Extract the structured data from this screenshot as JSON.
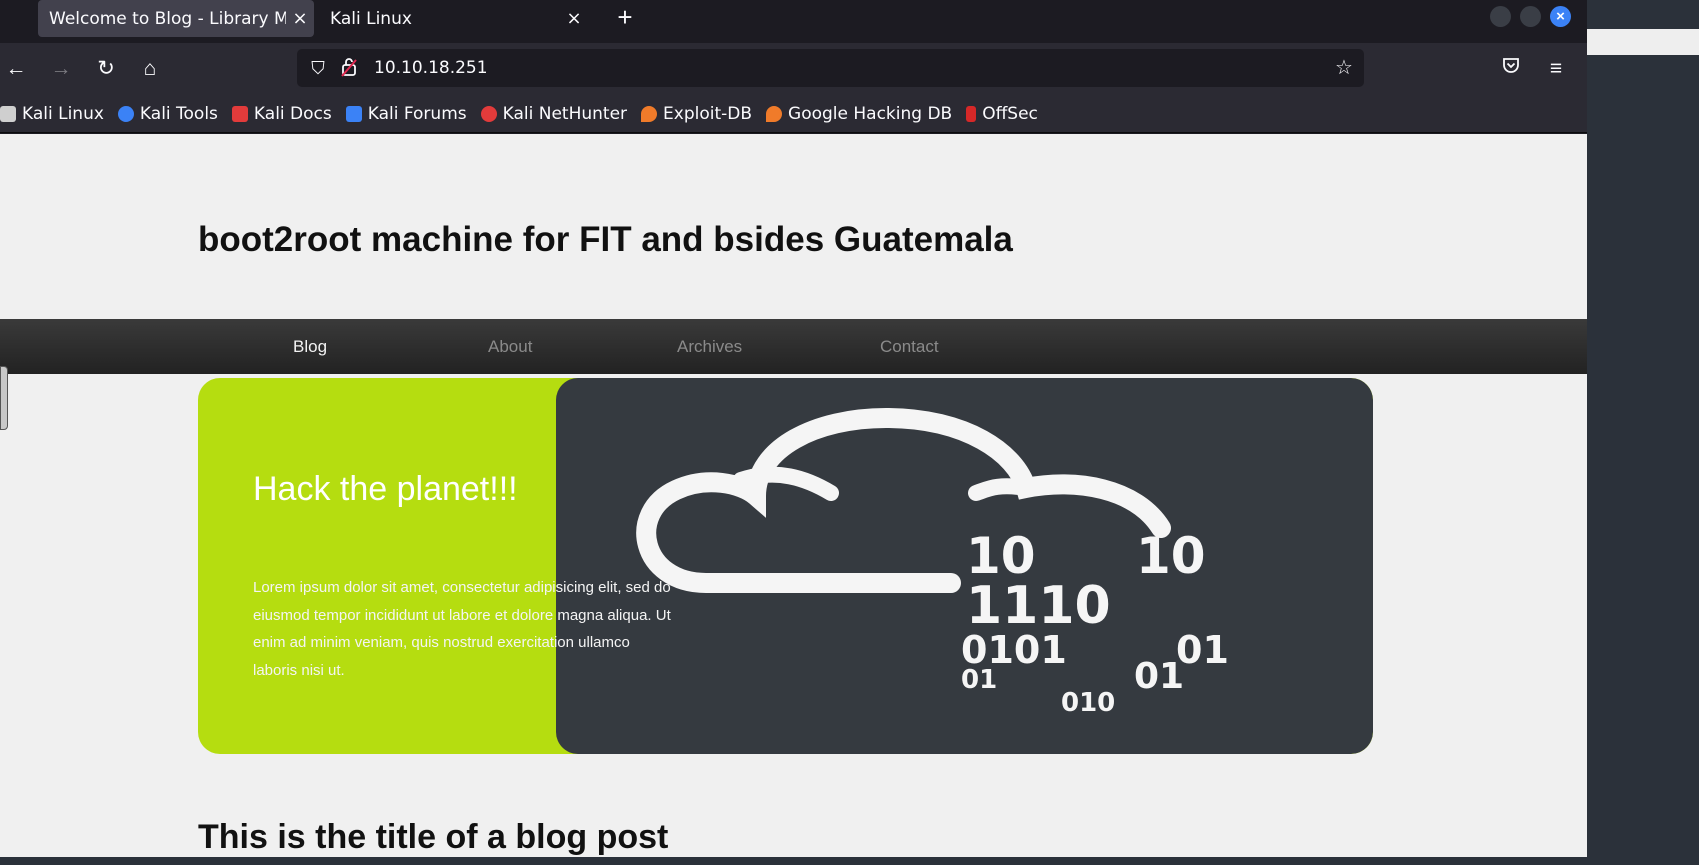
{
  "tabs": [
    {
      "title": "Welcome to Blog - Library Ma",
      "close": "×"
    },
    {
      "title": "Kali Linux",
      "close": "×"
    }
  ],
  "new_tab": "+",
  "toolbar": {
    "url": "10.10.18.251"
  },
  "bookmarks": [
    {
      "label": "Kali Linux",
      "icon": "kali-dragon-icon",
      "color": "#367bf0"
    },
    {
      "label": "Kali Tools",
      "icon": "kali-tools-icon",
      "color": "#3b82f6"
    },
    {
      "label": "Kali Docs",
      "icon": "kali-docs-icon",
      "color": "#e23b3b"
    },
    {
      "label": "Kali Forums",
      "icon": "kali-forums-icon",
      "color": "#3b82f6"
    },
    {
      "label": "Kali NetHunter",
      "icon": "nethunter-icon",
      "color": "#e23b3b"
    },
    {
      "label": "Exploit-DB",
      "icon": "exploit-db-icon",
      "color": "#f07b2a"
    },
    {
      "label": "Google Hacking DB",
      "icon": "ghdb-icon",
      "color": "#f07b2a"
    },
    {
      "label": "OffSec",
      "icon": "offsec-icon",
      "color": "#d62828"
    }
  ],
  "site": {
    "title": "boot2root machine for FIT and bsides Guatemala",
    "nav": [
      "Blog",
      "About",
      "Archives",
      "Contact"
    ],
    "hero_title": "Hack the planet!!!",
    "hero_text": "Lorem ipsum dolor sit amet, consectetur adipisicing elit, sed do eiusmod tempor incididunt ut labore et dolore magna aliqua. Ut enim ad minim veniam, quis nostrud exercitation ullamco laboris nisi ut.",
    "hero_binary": [
      "10",
      "10",
      "1110",
      "0101",
      "01",
      "01",
      "010",
      "01"
    ],
    "post_title": "This is the title of a blog post"
  },
  "colors": {
    "hero_accent": "#b5dd10",
    "hero_image_bg": "#353a40"
  }
}
